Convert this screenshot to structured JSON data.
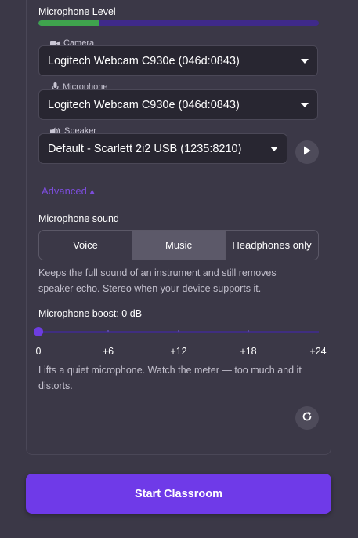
{
  "mic_level": {
    "label": "Microphone Level",
    "level": 0.215
  },
  "camera": {
    "label": "Camera",
    "value": "Logitech Webcam C930e (046d:0843)"
  },
  "microphone": {
    "label": "Microphone",
    "value": "Logitech Webcam C930e (046d:0843)"
  },
  "speaker": {
    "label": "Speaker",
    "value": "Default - Scarlett 2i2 USB (1235:8210)"
  },
  "advanced": {
    "label": "Advanced ▴"
  },
  "mic_sound": {
    "label": "Microphone sound",
    "options": [
      "Voice",
      "Music",
      "Headphones only"
    ],
    "selected": "Music",
    "help": "Keeps the full sound of an instrument and still removes speaker echo. Stereo when your device supports it."
  },
  "boost": {
    "label": "Microphone boost: 0 dB",
    "value": 0,
    "ticks": [
      "0",
      "+6",
      "+12",
      "+18",
      "+24"
    ],
    "help": "Lifts a quiet microphone. Watch the meter — too much and it distorts."
  },
  "start_button": {
    "label": "Start Classroom"
  },
  "colors": {
    "accent": "#6f3ae8",
    "meter_green": "#3fa34d",
    "background": "#3b3847"
  }
}
